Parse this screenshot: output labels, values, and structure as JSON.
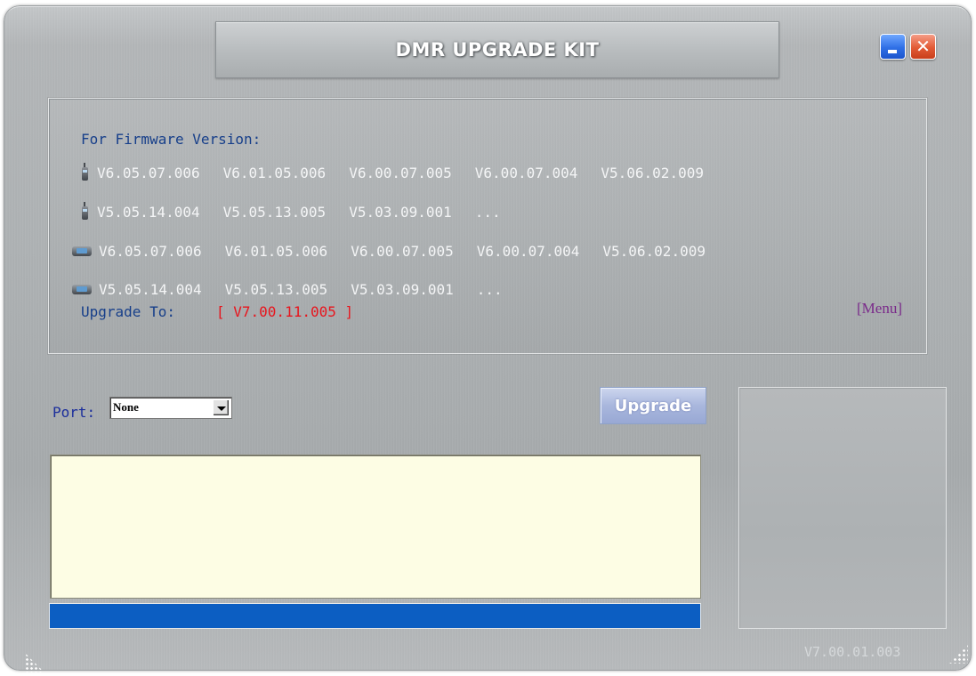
{
  "window": {
    "title": "DMR UPGRADE KIT",
    "minimize_icon": "minimize-icon",
    "close_icon": "close-icon",
    "close_glyph": "✕"
  },
  "firmware": {
    "label": "For Firmware Version:",
    "rows": [
      {
        "icon": "handheld-radio-icon",
        "versions": [
          "V6.05.07.006",
          "V6.01.05.006",
          "V6.00.07.005",
          "V6.00.07.004",
          "V5.06.02.009"
        ]
      },
      {
        "icon": "handheld-radio-icon",
        "versions": [
          "V5.05.14.004",
          "V5.05.13.005",
          "V5.03.09.001",
          "..."
        ]
      },
      {
        "icon": "mobile-radio-icon",
        "versions": [
          "V6.05.07.006",
          "V6.01.05.006",
          "V6.00.07.005",
          "V6.00.07.004",
          "V5.06.02.009"
        ]
      },
      {
        "icon": "mobile-radio-icon",
        "versions": [
          "V5.05.14.004",
          "V5.05.13.005",
          "V5.03.09.001",
          "..."
        ]
      }
    ],
    "upgrade_label": "Upgrade To:",
    "upgrade_version": "[ V7.00.11.005 ]",
    "menu_label": "[Menu]"
  },
  "port": {
    "label": "Port:",
    "selected": "None",
    "dropdown_icon": "chevron-down-icon"
  },
  "upgrade_button": {
    "label": "Upgrade"
  },
  "log": {
    "text": ""
  },
  "progress": {
    "fraction": 1.0
  },
  "footer": {
    "version": "V7.00.01.003"
  },
  "colors": {
    "label_blue": "#173f8a",
    "version_red": "#e8151d",
    "menu_purple": "#7a2a8a",
    "progress_blue": "#0c5ec2",
    "log_background": "#fdfde4"
  }
}
